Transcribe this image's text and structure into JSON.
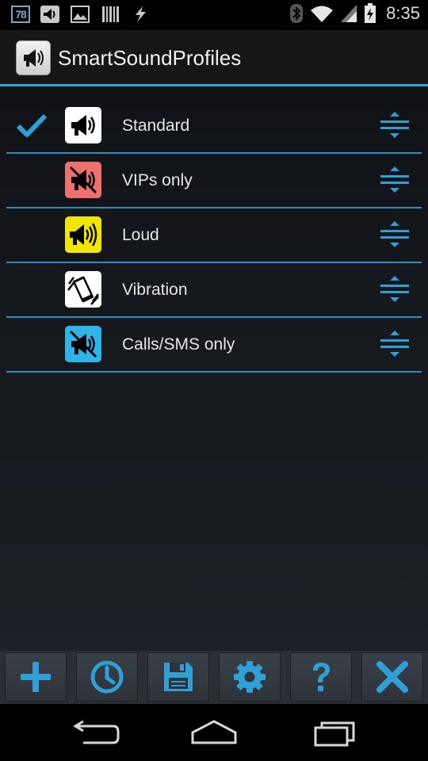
{
  "status_bar": {
    "badge": "78",
    "time": "8:35",
    "icons": [
      "notification-badge",
      "speaker-icon",
      "image-icon",
      "barcode-icon",
      "flash-icon",
      "bluetooth-icon",
      "wifi-icon",
      "signal-icon",
      "battery-charging-icon"
    ]
  },
  "action_bar": {
    "title": "SmartSoundProfiles",
    "icon": "megaphone-icon"
  },
  "profiles": [
    {
      "label": "Standard",
      "active": true,
      "icon": "megaphone-icon",
      "color": "#ffffff"
    },
    {
      "label": "VIPs only",
      "active": false,
      "icon": "megaphone-muted-icon",
      "color": "#f07070"
    },
    {
      "label": "Loud",
      "active": false,
      "icon": "megaphone-loud-icon",
      "color": "#f2e600"
    },
    {
      "label": "Vibration",
      "active": false,
      "icon": "vibrate-phone-icon",
      "color": "#ffffff"
    },
    {
      "label": "Calls/SMS only",
      "active": false,
      "icon": "megaphone-muted-icon",
      "color": "#2fb4e9"
    }
  ],
  "toolbar": {
    "buttons": [
      "add-icon",
      "clock-icon",
      "save-icon",
      "settings-gear-icon",
      "help-icon",
      "close-icon"
    ]
  },
  "colors": {
    "accent": "#33a3d6",
    "toolbar_icon": "#2f9fd6"
  },
  "nav_bar": [
    "back-icon",
    "home-icon",
    "recents-icon"
  ]
}
